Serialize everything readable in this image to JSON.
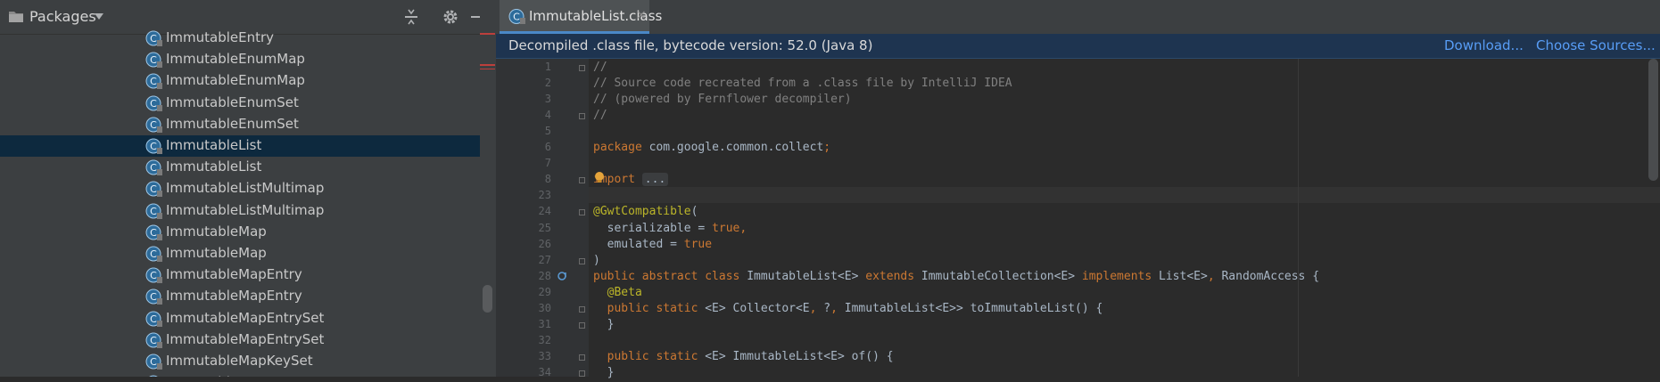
{
  "colors": {
    "keyword": "#cc7832",
    "comment": "#808080",
    "annotation": "#bbb529",
    "link": "#589df6",
    "selection": "#0d293e",
    "banner": "#1e3450"
  },
  "project_panel": {
    "title": "Packages",
    "icons": [
      "folder-icon",
      "caret-down-icon",
      "collapse-all-icon",
      "gear-icon",
      "minimize-icon"
    ],
    "tree_items": [
      {
        "label": "ImmutableEntry"
      },
      {
        "label": "ImmutableEnumMap"
      },
      {
        "label": "ImmutableEnumMap"
      },
      {
        "label": "ImmutableEnumSet"
      },
      {
        "label": "ImmutableEnumSet"
      },
      {
        "label": "ImmutableList",
        "selected": true
      },
      {
        "label": "ImmutableList"
      },
      {
        "label": "ImmutableListMultimap"
      },
      {
        "label": "ImmutableListMultimap"
      },
      {
        "label": "ImmutableMap"
      },
      {
        "label": "ImmutableMap"
      },
      {
        "label": "ImmutableMapEntry"
      },
      {
        "label": "ImmutableMapEntry"
      },
      {
        "label": "ImmutableMapEntrySet"
      },
      {
        "label": "ImmutableMapEntrySet"
      },
      {
        "label": "ImmutableMapKeySet"
      },
      {
        "label": "ImmutableMapKeySet"
      }
    ]
  },
  "editor": {
    "tab": {
      "label": "ImmutableList.class",
      "close": "×"
    },
    "banner": {
      "text": "Decompiled .class file, bytecode version: 52.0 (Java 8)",
      "download": "Download...",
      "choose_sources": "Choose Sources..."
    },
    "line_numbers": [
      "1",
      "2",
      "3",
      "4",
      "5",
      "6",
      "7",
      "8",
      "23",
      "24",
      "25",
      "26",
      "27",
      "28",
      "29",
      "30",
      "31",
      "32",
      "33",
      "34"
    ],
    "code_lines": [
      [
        {
          "t": "//",
          "c": "cm"
        }
      ],
      [
        {
          "t": "// Source code recreated from a .class file by IntelliJ IDEA",
          "c": "cm"
        }
      ],
      [
        {
          "t": "// (powered by Fernflower decompiler)",
          "c": "cm"
        }
      ],
      [
        {
          "t": "//",
          "c": "cm"
        }
      ],
      [],
      [
        {
          "t": "package",
          "c": "kw"
        },
        {
          "t": " com.google.common.collect"
        },
        {
          "t": ";",
          "c": "kw"
        }
      ],
      [],
      [
        {
          "t": "import",
          "c": "kw"
        },
        {
          "t": " "
        },
        {
          "t": "...",
          "c": "fold"
        }
      ],
      [],
      [
        {
          "t": "@GwtCompatible",
          "c": "an"
        },
        {
          "t": "("
        }
      ],
      [
        {
          "t": "  serializable = "
        },
        {
          "t": "true",
          "c": "kw"
        },
        {
          "t": ",",
          "c": "kw"
        }
      ],
      [
        {
          "t": "  emulated = "
        },
        {
          "t": "true",
          "c": "kw"
        }
      ],
      [
        {
          "t": ")"
        }
      ],
      [
        {
          "t": "public abstract class",
          "c": "kw"
        },
        {
          "t": " ImmutableList<E> "
        },
        {
          "t": "extends",
          "c": "kw"
        },
        {
          "t": " ImmutableCollection<E> "
        },
        {
          "t": "implements",
          "c": "kw"
        },
        {
          "t": " List<E>"
        },
        {
          "t": ",",
          "c": "kw"
        },
        {
          "t": " RandomAccess {"
        }
      ],
      [
        {
          "t": "  @Beta",
          "c": "an"
        }
      ],
      [
        {
          "t": "  public static",
          "c": "kw"
        },
        {
          "t": " <E> Collector<E"
        },
        {
          "t": ",",
          "c": "kw"
        },
        {
          "t": " ?"
        },
        {
          "t": ",",
          "c": "kw"
        },
        {
          "t": " ImmutableList<E>> toImmutableList() {"
        }
      ],
      [
        {
          "t": "  }"
        }
      ],
      [],
      [
        {
          "t": "  public static",
          "c": "kw"
        },
        {
          "t": " <E> ImmutableList<E> of() {"
        }
      ],
      [
        {
          "t": "  }"
        }
      ]
    ]
  }
}
